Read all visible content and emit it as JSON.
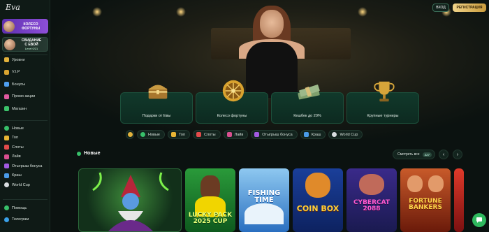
{
  "brand": {
    "logo": "Eva"
  },
  "header": {
    "login": "ВХОД",
    "register": "РЕГИСТРАЦИЯ"
  },
  "sidebar": {
    "promo_wheel": {
      "line1": "КОЛЕСО",
      "line2": "ФОРТУНЫ"
    },
    "promo_date": {
      "line1": "СВИДАНИЕ",
      "line2": "С ЕВОЙ",
      "level": "Level 0/21"
    },
    "menu1": [
      {
        "label": "Уровни",
        "color": "#e2b23c"
      },
      {
        "label": "V.I.P",
        "color": "#d9a531"
      },
      {
        "label": "Бонусы",
        "color": "#4fa0f0"
      },
      {
        "label": "Промо акции",
        "color": "#e05aa0"
      },
      {
        "label": "Магазин",
        "color": "#3cc46b"
      }
    ],
    "menu2": [
      {
        "label": "Новые",
        "color": "#38c06a"
      },
      {
        "label": "Топ",
        "color": "#e8b534"
      },
      {
        "label": "Слоты",
        "color": "#e24b4b"
      },
      {
        "label": "Лайв",
        "color": "#d84f8f"
      },
      {
        "label": "Отыгрыш бонуса",
        "color": "#a25ae0"
      },
      {
        "label": "Краш",
        "color": "#4a9be8"
      },
      {
        "label": "World Cup",
        "color": "#d9dde0"
      }
    ],
    "menu3": [
      {
        "label": "Помощь",
        "color": "#38c06a"
      },
      {
        "label": "Телеграм",
        "color": "#3aa0e8"
      }
    ]
  },
  "feature_cards": [
    {
      "label": "Подарки от Евы",
      "icon": "treasure-chest-icon",
      "color": "#c89a42"
    },
    {
      "label": "Колесо фортуны",
      "icon": "fortune-wheel-icon",
      "color": "#d9a22e"
    },
    {
      "label": "Кешбек до 20%",
      "icon": "cash-stack-icon",
      "color": "#9cb98a"
    },
    {
      "label": "Крупные турниры",
      "icon": "trophy-icon",
      "color": "#d6a53a"
    }
  ],
  "filter_chips": [
    {
      "label": "Новые",
      "color": "#38c06a"
    },
    {
      "label": "Топ",
      "color": "#e8b534"
    },
    {
      "label": "Слоты",
      "color": "#e24b4b"
    },
    {
      "label": "Лайв",
      "color": "#d84f8f"
    },
    {
      "label": "Отыгрыш бонуса",
      "color": "#a25ae0"
    },
    {
      "label": "Краш",
      "color": "#4a9be8"
    },
    {
      "label": "World Cup",
      "color": "#d9dde0"
    }
  ],
  "new_section": {
    "title": "Новые",
    "see_all": "Смотреть все",
    "count": "227",
    "prev": "‹",
    "next": "›"
  },
  "games": [
    {
      "title": "",
      "bg": "#1d5a2a"
    },
    {
      "title": "LUCKY PACK 2025 CUP",
      "bg": "#1f8f2a"
    },
    {
      "title": "FISHING TIME",
      "bg": "#3d8fd8"
    },
    {
      "title": "COIN BOX",
      "bg": "#1f4fc0"
    },
    {
      "title": "CYBERCAT 2088",
      "bg": "#2a3aa0"
    },
    {
      "title": "FORTUNE BANKERS",
      "bg": "#b0421e"
    },
    {
      "title": "",
      "bg": "#c0302a"
    }
  ]
}
